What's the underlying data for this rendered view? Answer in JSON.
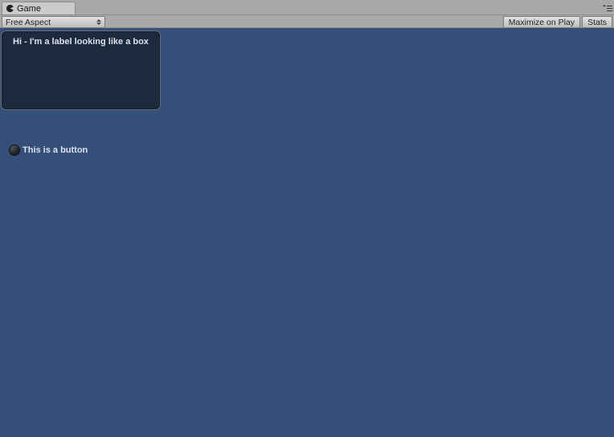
{
  "tab": {
    "title": "Game",
    "icon": "pacman-icon"
  },
  "toolbar": {
    "aspect": {
      "value": "Free Aspect"
    },
    "maximize_label": "Maximize on Play",
    "stats_label": "Stats"
  },
  "gui": {
    "box_label": "Hi - I'm a label looking like a box",
    "toggle_label": "This is a button"
  },
  "colors": {
    "bg": "#355078",
    "box": "#1d2a3d"
  }
}
